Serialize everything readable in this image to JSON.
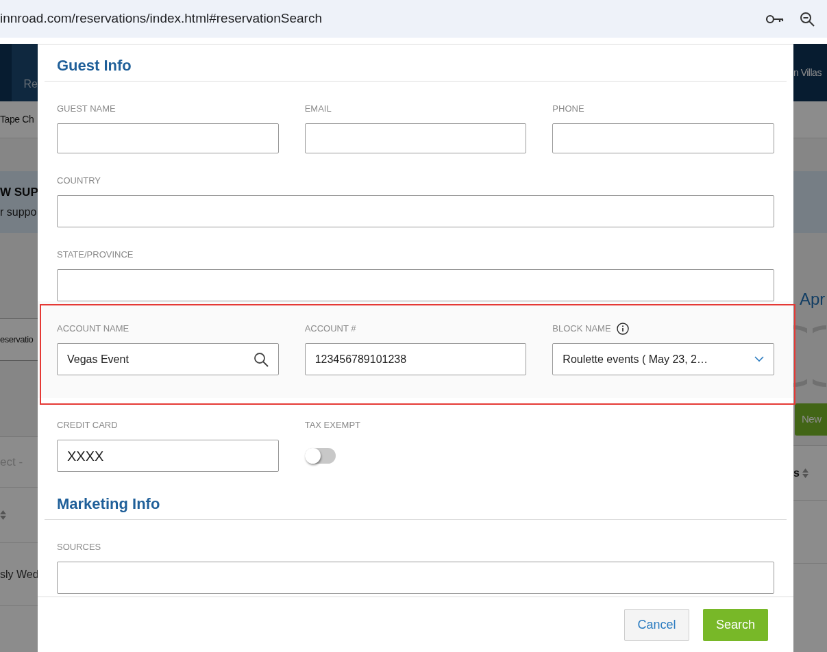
{
  "browser": {
    "url": "innroad.com/reservations/index.html#reservationSearch"
  },
  "background": {
    "nav_tab": "Re",
    "property": "n Villas",
    "subnav": "Tape Ch",
    "banner_title": "W SUP",
    "banner_text": "r suppo",
    "search_tab": "eservatio",
    "select": "ect -",
    "heading": "Apr",
    "new_button": "New",
    "column_header": "s",
    "row_text": "sly Wed"
  },
  "modal": {
    "sections": [
      {
        "title": "Guest Info",
        "rows": [
          [
            {
              "label": "GUEST NAME",
              "kind": "text"
            },
            {
              "label": "EMAIL",
              "kind": "text"
            },
            {
              "label": "PHONE",
              "kind": "text"
            }
          ],
          [
            {
              "label": "COUNTRY",
              "kind": "text",
              "wide": true
            }
          ],
          [
            {
              "label": "STATE/PROVINCE",
              "kind": "text",
              "wide": true
            }
          ],
          [
            {
              "label": "ACCOUNT NAME",
              "kind": "search",
              "value": "Vegas Event",
              "highlighted": true
            },
            {
              "label": "ACCOUNT #",
              "kind": "text",
              "value": "123456789101238"
            },
            {
              "label": "BLOCK NAME",
              "kind": "select",
              "value": "Roulette events ( May 23, 2…",
              "info": true
            }
          ],
          [
            {
              "label": "CREDIT CARD",
              "kind": "text",
              "value": "XXXX"
            },
            {
              "label": "TAX EXEMPT",
              "kind": "toggle",
              "on": false
            }
          ]
        ]
      },
      {
        "title": "Marketing Info",
        "rows": [
          [
            {
              "label": "SOURCES",
              "kind": "text",
              "wide": true
            }
          ]
        ]
      }
    ],
    "buttons": [
      {
        "label": "Cancel",
        "kind": "secondary"
      },
      {
        "label": "Search",
        "kind": "primary"
      }
    ]
  }
}
